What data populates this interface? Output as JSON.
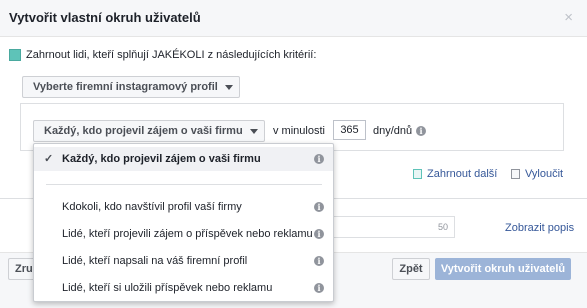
{
  "dialog": {
    "title": "Vytvořit vlastní okruh uživatelů",
    "close_label": "×"
  },
  "rule": {
    "include_text": "Zahrnout lidi, kteří splňují JAKÉKOLI z následujících kritérií:",
    "profile_select": "Vyberte firemní instagramový profil",
    "event_select": "Každý, kdo projevil zájem o vaši firmu",
    "in_last_label": "v minulosti",
    "days_value": "365",
    "days_unit": "dny/dnů",
    "include_more": "Zahrnout další",
    "exclude": "Vyloučit"
  },
  "dropdown": {
    "options": [
      "Každý, kdo projevil zájem o vaši firmu",
      "Kdokoli, kdo navštívil profil vaší firmy",
      "Lidé, kteří projevili zájem o příspěvek nebo reklamu",
      "Lidé, kteří napsali na váš firemní profil",
      "Lidé, kteří si uložili příspěvek nebo reklamu"
    ],
    "selected_index": 0
  },
  "audience_name": {
    "char_limit": "50"
  },
  "show_description": "Zobrazit popis",
  "footer": {
    "left_button_partial": "Zru",
    "back": "Zpět",
    "create": "Vytvořit okruh uživatelů"
  },
  "icons": {
    "close": "close-icon",
    "info": "info-icon",
    "check": "check-icon",
    "caret": "caret-down-icon"
  },
  "colors": {
    "primary_button": "#9cb4d8",
    "link": "#365899",
    "include_marker": "#5ec3b8"
  }
}
